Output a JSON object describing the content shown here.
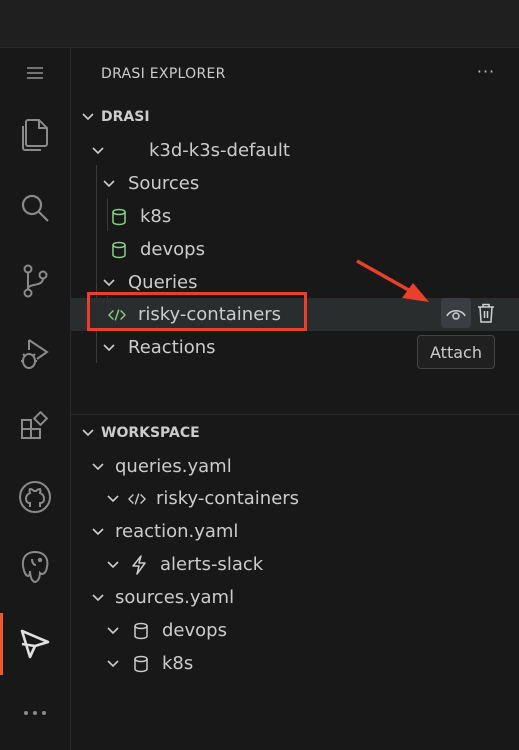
{
  "panel": {
    "title": "DRASI EXPLORER",
    "more_label": "···"
  },
  "drasi": {
    "section_label": "DRASI",
    "context": "k3d-k3s-default",
    "sources_label": "Sources",
    "sources": [
      "k8s",
      "devops"
    ],
    "queries_label": "Queries",
    "query": "risky-containers",
    "reactions_label": "Reactions",
    "attach_tooltip": "Attach"
  },
  "workspace": {
    "section_label": "WORKSPACE",
    "files": [
      {
        "name": "queries.yaml",
        "items": [
          "risky-containers"
        ]
      },
      {
        "name": "reaction.yaml",
        "items": [
          "alerts-slack"
        ]
      },
      {
        "name": "sources.yaml",
        "items": [
          "devops",
          "k8s"
        ]
      }
    ]
  },
  "colors": {
    "accent": "#f05a28",
    "source_icon": "#89d185",
    "highlight": "#e8402a"
  },
  "activity_icons": [
    "menu-icon",
    "explorer-icon",
    "search-icon",
    "source-control-icon",
    "run-debug-icon",
    "extensions-icon",
    "github-icon",
    "postgres-icon",
    "drasi-icon",
    "more-icon"
  ]
}
